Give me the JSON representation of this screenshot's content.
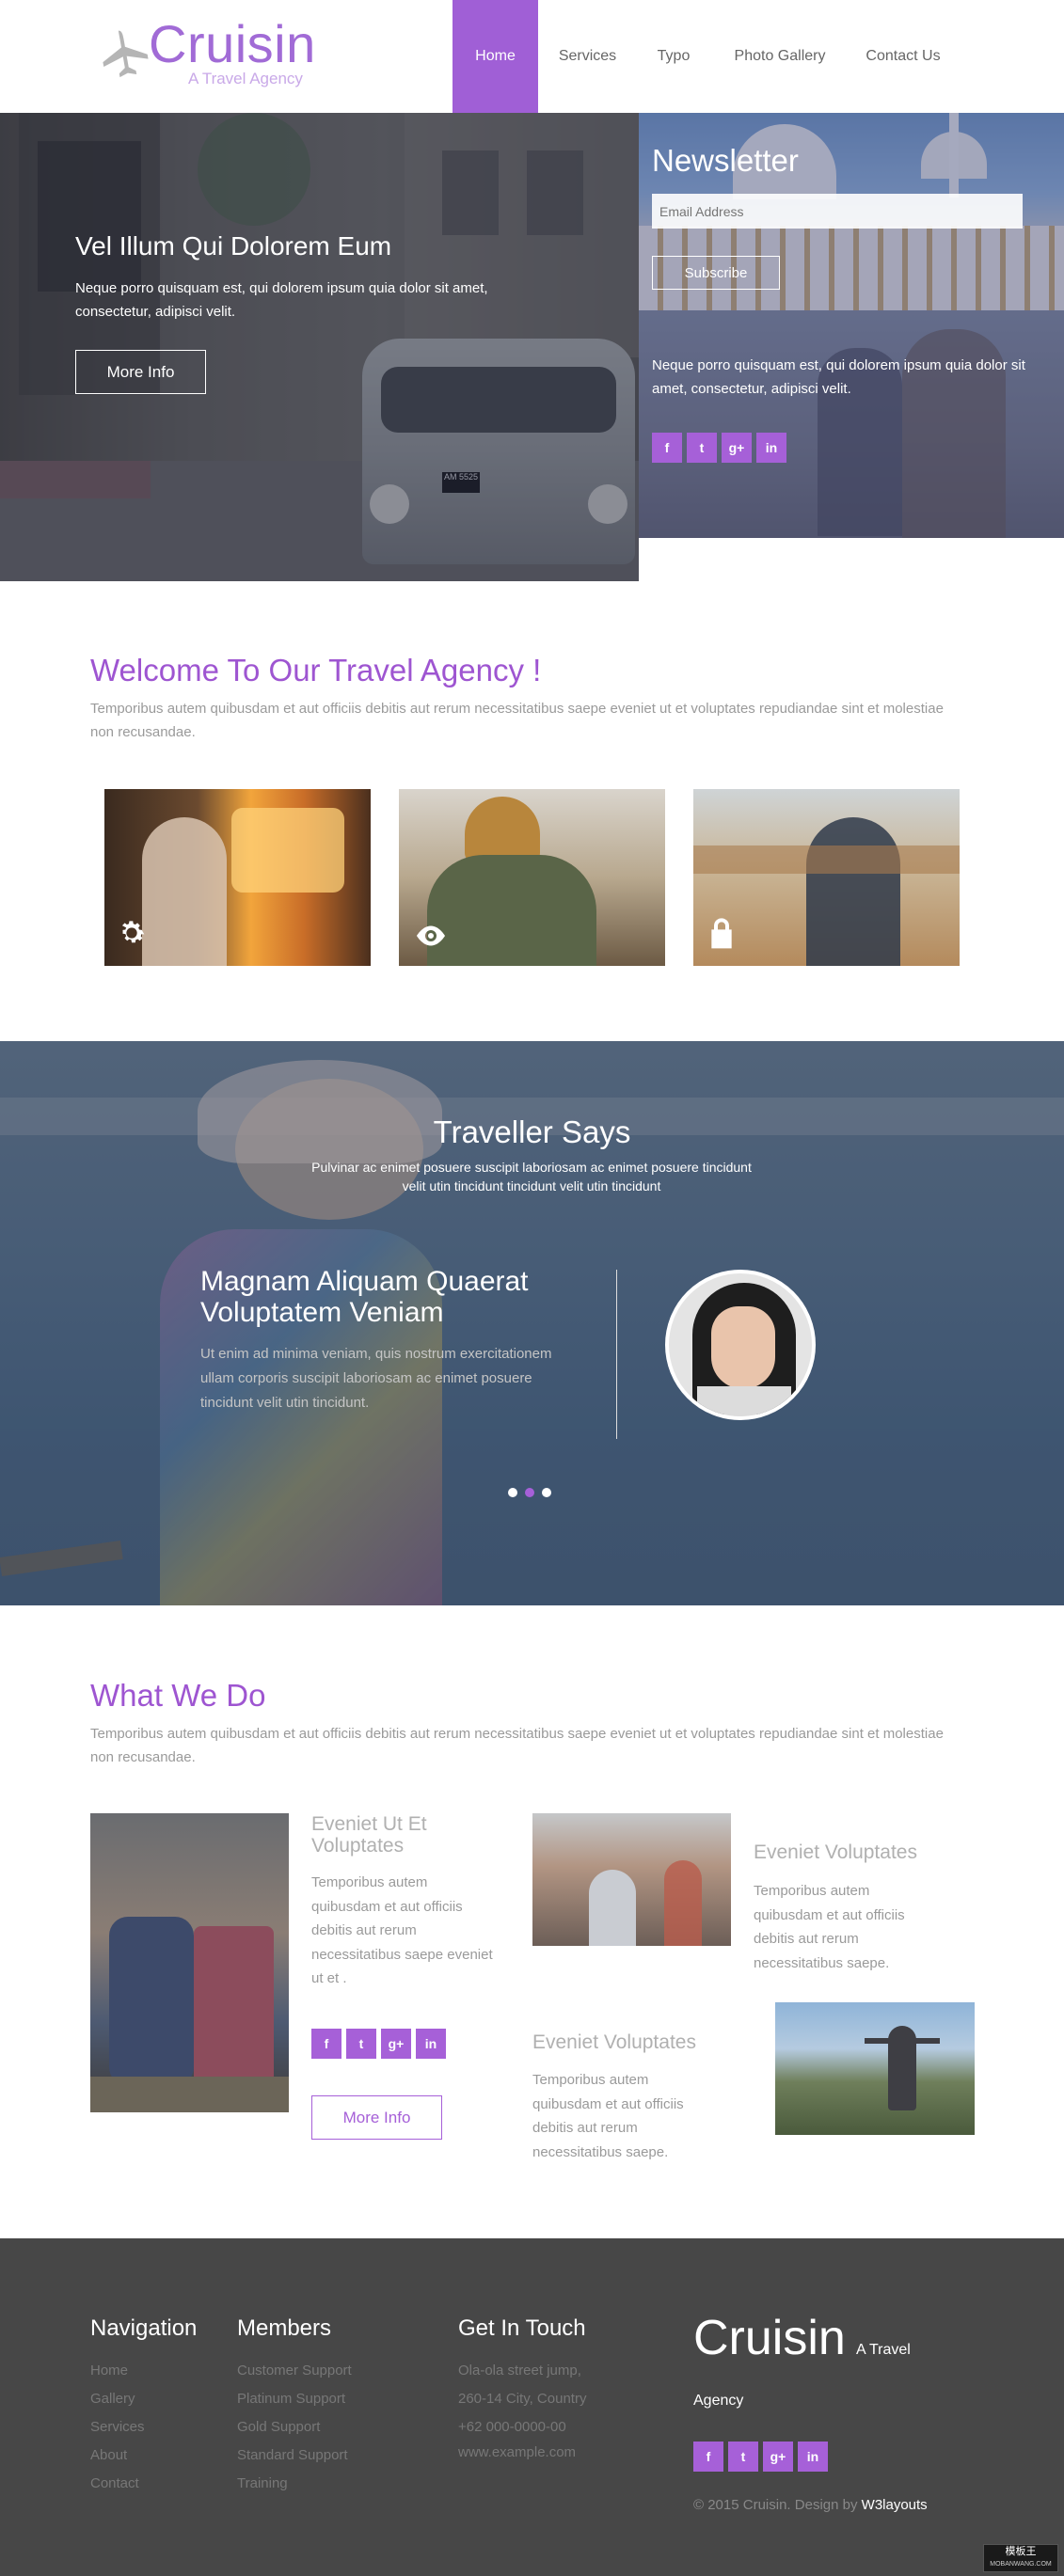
{
  "header": {
    "logo_title": "Cruisin",
    "logo_tagline": "A Travel Agency",
    "nav": [
      "Home",
      "Services",
      "Typo",
      "Photo Gallery",
      "Contact Us"
    ]
  },
  "hero": {
    "heading": "Vel Illum Qui Dolorem Eum",
    "text": "Neque porro quisquam est, qui dolorem ipsum quia dolor sit amet, consectetur, adipisci velit.",
    "button": "More Info",
    "van_plate": "AM 5525"
  },
  "newsletter": {
    "title": "Newsletter",
    "email_placeholder": "Email Address",
    "subscribe": "Subscribe",
    "text": "Neque porro quisquam est, qui dolorem ipsum quia dolor sit amet, consectetur, adipisci velit.",
    "social": [
      "f",
      "t",
      "g+",
      "in"
    ]
  },
  "welcome": {
    "title": "Welcome To Our Travel Agency !",
    "text": "Temporibus autem quibusdam et aut officiis debitis aut rerum necessitatibus saepe eveniet ut et voluptates repudiandae sint et molestiae non recusandae.",
    "cards": [
      {
        "icon": "gear-icon"
      },
      {
        "icon": "eye-icon"
      },
      {
        "icon": "lock-icon"
      }
    ]
  },
  "testimonial": {
    "title": "Traveller Says",
    "subtitle": "Pulvinar ac enimet posuere suscipit laboriosam ac enimet posuere tincidunt velit utin tincidunt tincidunt velit utin tincidunt",
    "quote_title": "Magnam Aliquam Quaerat Voluptatem Veniam",
    "quote_text": "Ut enim ad minima veniam, quis nostrum exercitationem ullam corporis suscipit laboriosam ac enimet posuere tincidunt velit utin tincidunt."
  },
  "whatwedo": {
    "title": "What We Do",
    "text": "Temporibus autem quibusdam et aut officiis debitis aut rerum necessitatibus saepe eveniet ut et voluptates repudiandae sint et molestiae non recusandae.",
    "item1": {
      "title": "Eveniet Ut Et Voluptates",
      "text": "Temporibus autem quibusdam et aut officiis debitis aut rerum necessitatibus saepe eveniet ut et .",
      "button": "More Info"
    },
    "item2": {
      "title": "Eveniet Voluptates",
      "text": "Temporibus autem quibusdam et aut officiis debitis aut rerum necessitatibus saepe."
    },
    "item3": {
      "title": "Eveniet Voluptates",
      "text": "Temporibus autem quibusdam et aut officiis debitis aut rerum necessitatibus saepe."
    },
    "social": [
      "f",
      "t",
      "g+",
      "in"
    ]
  },
  "footer": {
    "nav_title": "Navigation",
    "nav_links": [
      "Home",
      "Gallery",
      "Services",
      "About",
      "Contact"
    ],
    "members_title": "Members",
    "members_links": [
      "Customer Support",
      "Platinum Support",
      "Gold Support",
      "Standard Support",
      "Training"
    ],
    "contact_title": "Get In Touch",
    "contact_lines": [
      "Ola-ola street jump,",
      "260-14 City, Country",
      "+62 000-0000-00",
      "www.example.com"
    ],
    "brand": "Cruisin",
    "brand_tag_line1": "A Travel",
    "brand_tag_line2": "Agency",
    "social": [
      "f",
      "t",
      "g+",
      "in"
    ],
    "copyright": "© 2015 Cruisin. Design by",
    "designer": "W3layouts",
    "watermark_top": "模板王",
    "watermark_bottom": "MOBANWANG.COM"
  },
  "colors": {
    "accent": "#a05fd6",
    "footer_bg": "#474747"
  }
}
